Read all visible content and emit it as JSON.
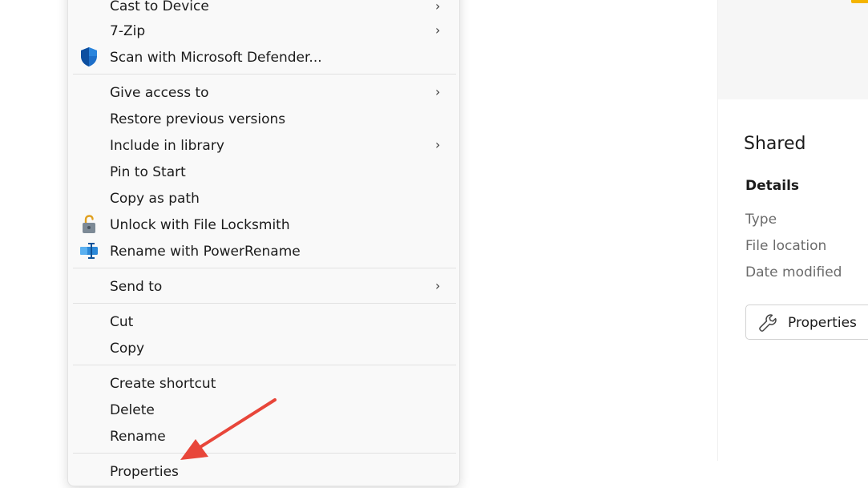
{
  "context_menu": {
    "items": [
      {
        "label": "Cast to Device",
        "submenu": true
      },
      {
        "label": "7-Zip",
        "submenu": true
      },
      {
        "label": "Scan with Microsoft Defender...",
        "icon": "defender-shield-icon"
      },
      {
        "label": "Give access to",
        "submenu": true
      },
      {
        "label": "Restore previous versions"
      },
      {
        "label": "Include in library",
        "submenu": true
      },
      {
        "label": "Pin to Start"
      },
      {
        "label": "Copy as path"
      },
      {
        "label": "Unlock with File Locksmith",
        "icon": "padlock-icon"
      },
      {
        "label": "Rename with PowerRename",
        "icon": "power-rename-icon"
      },
      {
        "label": "Send to",
        "submenu": true
      },
      {
        "label": "Cut"
      },
      {
        "label": "Copy"
      },
      {
        "label": "Create shortcut"
      },
      {
        "label": "Delete"
      },
      {
        "label": "Rename"
      },
      {
        "label": "Properties"
      }
    ]
  },
  "details_pane": {
    "title": "Shared",
    "details_heading": "Details",
    "fields": [
      "Type",
      "File location",
      "Date modified"
    ],
    "properties_button": {
      "label": "Properties",
      "icon": "wrench-icon"
    }
  },
  "annotation": {
    "arrow_color": "#e8463a",
    "points_to": "Properties"
  }
}
